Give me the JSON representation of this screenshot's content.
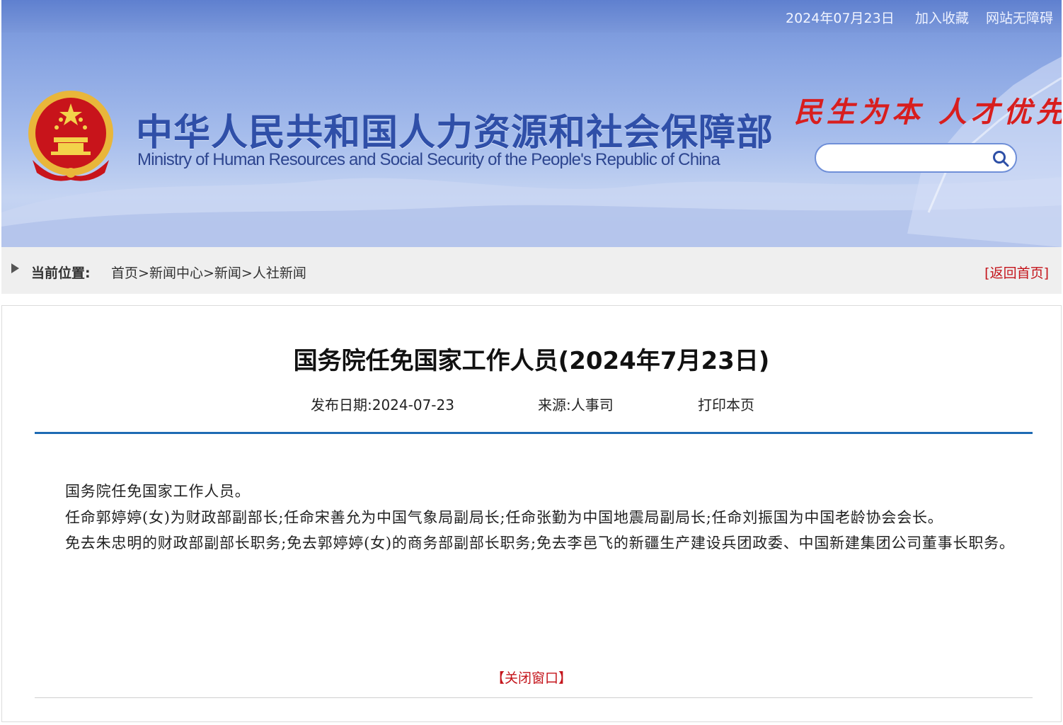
{
  "topbar": {
    "date": "2024年07月23日",
    "bookmark_label": "加入收藏",
    "accessibility_label": "网站无障碍"
  },
  "header": {
    "title_cn": "中华人民共和国人力资源和社会保障部",
    "title_en": "Ministry of Human Resources and Social Security of the People's Republic of China",
    "slogan": "民生为本 人才优先",
    "search": {
      "placeholder": "",
      "icon": "search-icon"
    }
  },
  "breadcrumb": {
    "label": "当前位置:",
    "items": [
      "首页",
      "新闻中心",
      "新闻",
      "人社新闻"
    ],
    "separator": ">",
    "home_link": "[返回首页]"
  },
  "article": {
    "title": "国务院任免国家工作人员(2024年7月23日)",
    "publish_date": "发布日期:2024-07-23",
    "source": "来源:人事司",
    "print_label": "打印本页",
    "paragraphs": [
      "国务院任免国家工作人员。",
      "任命郭婷婷(女)为财政部副部长;任命宋善允为中国气象局副局长;任命张勤为中国地震局副局长;任命刘振国为中国老龄协会会长。",
      "免去朱忠明的财政部副部长职务;免去郭婷婷(女)的商务部副部长职务;免去李邑飞的新疆生产建设兵团政委、中国新建集团公司董事长职务。"
    ],
    "close_label": "【关闭窗口】"
  },
  "colors": {
    "header_blue": "#7b98da",
    "title_blue": "#2f4fa8",
    "slogan_red": "#d81e1e",
    "link_red": "#c4141b",
    "rule_blue": "#1e6bb3"
  }
}
